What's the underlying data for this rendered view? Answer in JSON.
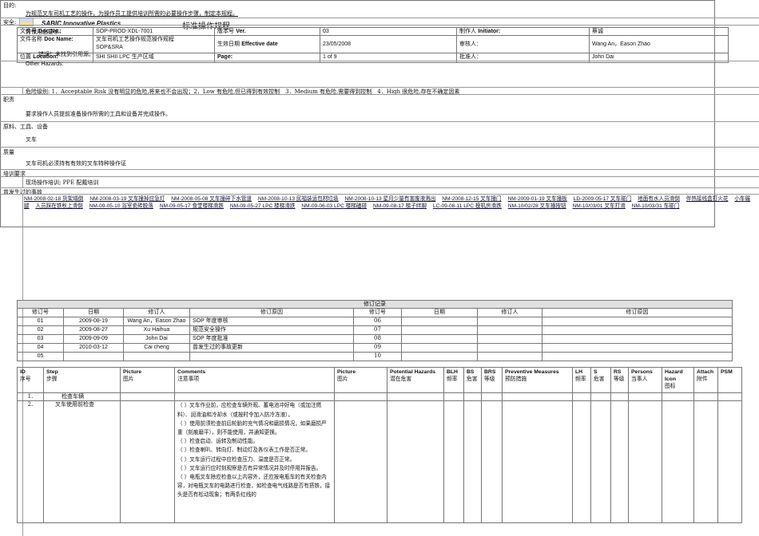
{
  "brand": "SABIC Innovative Plastics",
  "doc_title": "标准操作规程",
  "header": {
    "doc_no_label_cn": "文件号",
    "doc_no_label": "Doc No.:",
    "doc_no": "SOP-PROD-XDL-7001",
    "ver_label_cn": "版本号",
    "ver_label": "Ver.",
    "ver": "03",
    "initiator_label_cn": "制作人",
    "initiator_label": "Initiator:",
    "initiator": "蔡诚",
    "name_label_cn": "文件名称",
    "name_label": "Doc Name:",
    "doc_name_1": "叉车司机工艺操作规范操作规程",
    "doc_name_2": "SOP&SRA",
    "eff_label_cn": "生效日期",
    "eff_label": "Effective date",
    "eff": "23/05/2008",
    "reviewer_label": "审核人：",
    "reviewer": "Wang An，Eason Zhao",
    "loc_label_cn": "位置",
    "loc_label": "Location:",
    "loc": "SHI SHII LPC 生产区域",
    "page_label": "Page:",
    "page": "1 of 9",
    "approver_label": "批准人：",
    "approver": "John Dai"
  },
  "sections": {
    "purpose_label": "目的:",
    "purpose": "为规范叉车司机工艺的操作，为操作员工提供培训所需的必要操作步骤，制定本规程。",
    "safety_label": "安全:",
    "ppe_label": "劳保用品要求:",
    "ppe_error": "错误！未找到引用源。",
    "other_hazards": "Other Hazards:",
    "risk_levels": "危险级别: 1．Acceptable Risk 没有明显的危险,将来也不会出现；2．Low 有危险,但已得到有效控制　3．Medium 有危险,需要得到控制　4．High 很危险,存在不确定因素",
    "duty_label": "职责",
    "duty": "要求操作人员提前准备操作所需的工具和设备并完成操作。",
    "materials_label": "原料、工具、设备",
    "materials": "叉车",
    "quality_label": "质量",
    "quality": "叉车司机必须持有有效的叉车特种操作证",
    "training_label": "培训要求",
    "training": "现场操作培训; PPE 配戴培训",
    "accidents_label": "曾发生过的事故",
    "accidents": [
      "NM-2008-02-18 货架塌倒",
      "NM-2008-03-19 叉车撞掉应急灯",
      "NM-2008-05-08 叉车撞碎下水管道",
      "NM-2008-10-13 民福装运包材垃圾",
      "NM-2008-10-13 星月少量有害废液溅出",
      "NM-2008-12-15 叉车撞门",
      "NM-2009-01-19 叉车撞板",
      "LD-2009-05-17 叉车碰门",
      "地面有水人员滑倒",
      "伴热接线盒打火花",
      "小车碾腿",
      "人员踩在铁秋上滑倒",
      "NM-09-05-10 浴室瓷砖脱落",
      "NM-09-05-17 食堂楼梯滑跌",
      "NM-09-05-27 LPC 楼梯滑跌",
      "NM-09-06-03 LPC 楼梯磕碰",
      "NM-09-08-17 梯子绊脚",
      "LC-09-08-11 LPC 模机房滑跌",
      "NM-10/02/28 叉车撞按钮",
      "NM-10/03/01 叉车打滑",
      "NM-10/03/31 车碰门"
    ]
  },
  "revisions": {
    "caption": "修订记录",
    "headers": [
      "修订号",
      "日期",
      "修订人",
      "修订原因"
    ],
    "left": [
      [
        "01",
        "2009-08-19",
        "Wang An，Eason Zhao",
        "SOP 年度审核"
      ],
      [
        "02",
        "2009-08-27",
        "Xu Haihua",
        "规范安全操作"
      ],
      [
        "03",
        "2009-09-09",
        "John Dai",
        "SOP 年度批准"
      ],
      [
        "04",
        "2010-03-12",
        "Cai cheng",
        "曾发生过的事故更新"
      ],
      [
        "05",
        "",
        "",
        ""
      ]
    ],
    "right": [
      [
        "06",
        "",
        "",
        ""
      ],
      [
        "07",
        "",
        "",
        ""
      ],
      [
        "08",
        "",
        "",
        ""
      ],
      [
        "09",
        "",
        "",
        ""
      ],
      [
        "10",
        "",
        "",
        ""
      ]
    ]
  },
  "steps": {
    "headers": [
      [
        "ID",
        "序号"
      ],
      [
        "Step",
        "步骤"
      ],
      [
        "Picture",
        "图片"
      ],
      [
        "Comments",
        "注意事项"
      ],
      [
        "Picture",
        "图片"
      ],
      [
        "Potential Hazards",
        "潜在危害"
      ],
      [
        "BLH",
        "频率"
      ],
      [
        "BS",
        "危害"
      ],
      [
        "BRS",
        "等级"
      ],
      [
        "Preventive Measures",
        "预防措施"
      ],
      [
        "LH",
        "频率"
      ],
      [
        "S",
        "危害"
      ],
      [
        "RS",
        "等级"
      ],
      [
        "Persons",
        "当事人"
      ],
      [
        "Hazard Icon",
        "图标"
      ],
      [
        "Attach",
        "附件"
      ],
      [
        "PSM",
        ""
      ]
    ],
    "rows": [
      {
        "id": "1.",
        "step": "检查车辆",
        "comments": []
      },
      {
        "id": "2.",
        "step": "叉车使用前检查",
        "comments": [
          "（ ）叉车作业前，应检查车辆外观、蓄电池冲好电（或加注燃料）、润滑油和冷却水（或按时令加入防冷冻液）。",
          "（ ）使用前须检查前后轮胎的充气情况和磨损情况，如果磨损严重（刻痕磨平），则不能使用，并通知更换。",
          "（ ）检查启动、运转及制动性能。",
          "（ ）检查喇叭、转向灯、制动灯及各仪表工作是否正常。",
          "（ ）叉车运行过程中应检查压力、温度是否正常。",
          "（ ）叉车运行应时刻观察是否有异常情况并及时停用并报告。",
          "（ ）电瓶叉车除应检查以上内容外，还应按电瓶车的有关检查内容，对电瓶叉车的电路进行检查，如检查电气线路是否有搭铁，接头是否有松动现象；有两条红线的"
        ]
      }
    ]
  }
}
